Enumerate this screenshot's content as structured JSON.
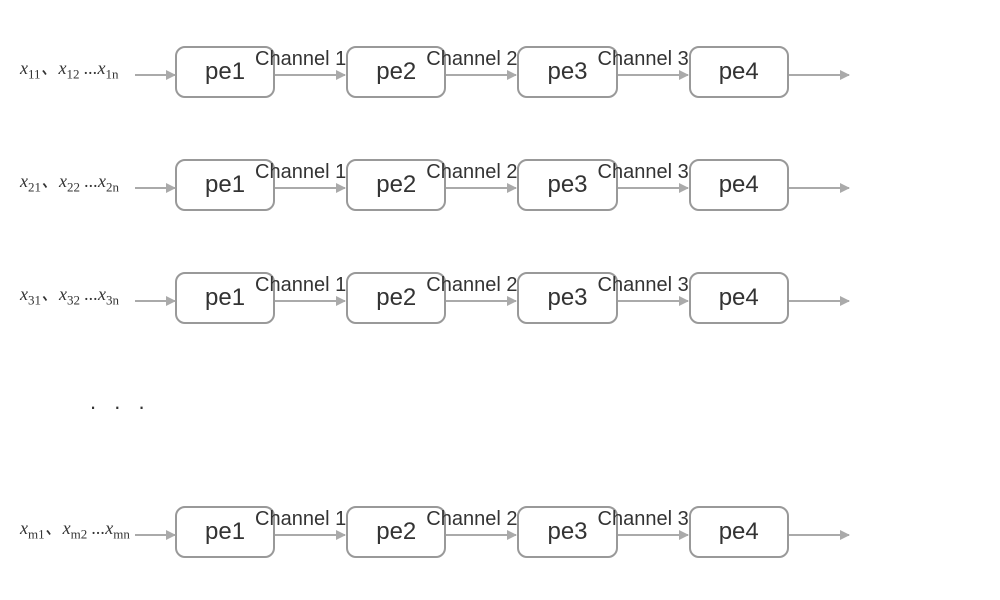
{
  "diagram": {
    "channel_labels": [
      "Channel 1",
      "Channel 2",
      "Channel 3"
    ],
    "node_labels": [
      "pe1",
      "pe2",
      "pe3",
      "pe4"
    ],
    "rows": [
      {
        "input_var": "x",
        "sub1": "11",
        "sub2": "12",
        "sub3": "1n"
      },
      {
        "input_var": "x",
        "sub1": "21",
        "sub2": "22",
        "sub3": "2n"
      },
      {
        "input_var": "x",
        "sub1": "31",
        "sub2": "32",
        "sub3": "3n"
      }
    ],
    "ellipsis": ". . .",
    "last_row": {
      "input_var": "x",
      "sub1": "m1",
      "sub2": "m2",
      "sub3": "mn"
    },
    "sep1": "、",
    "sep2": " ..."
  }
}
